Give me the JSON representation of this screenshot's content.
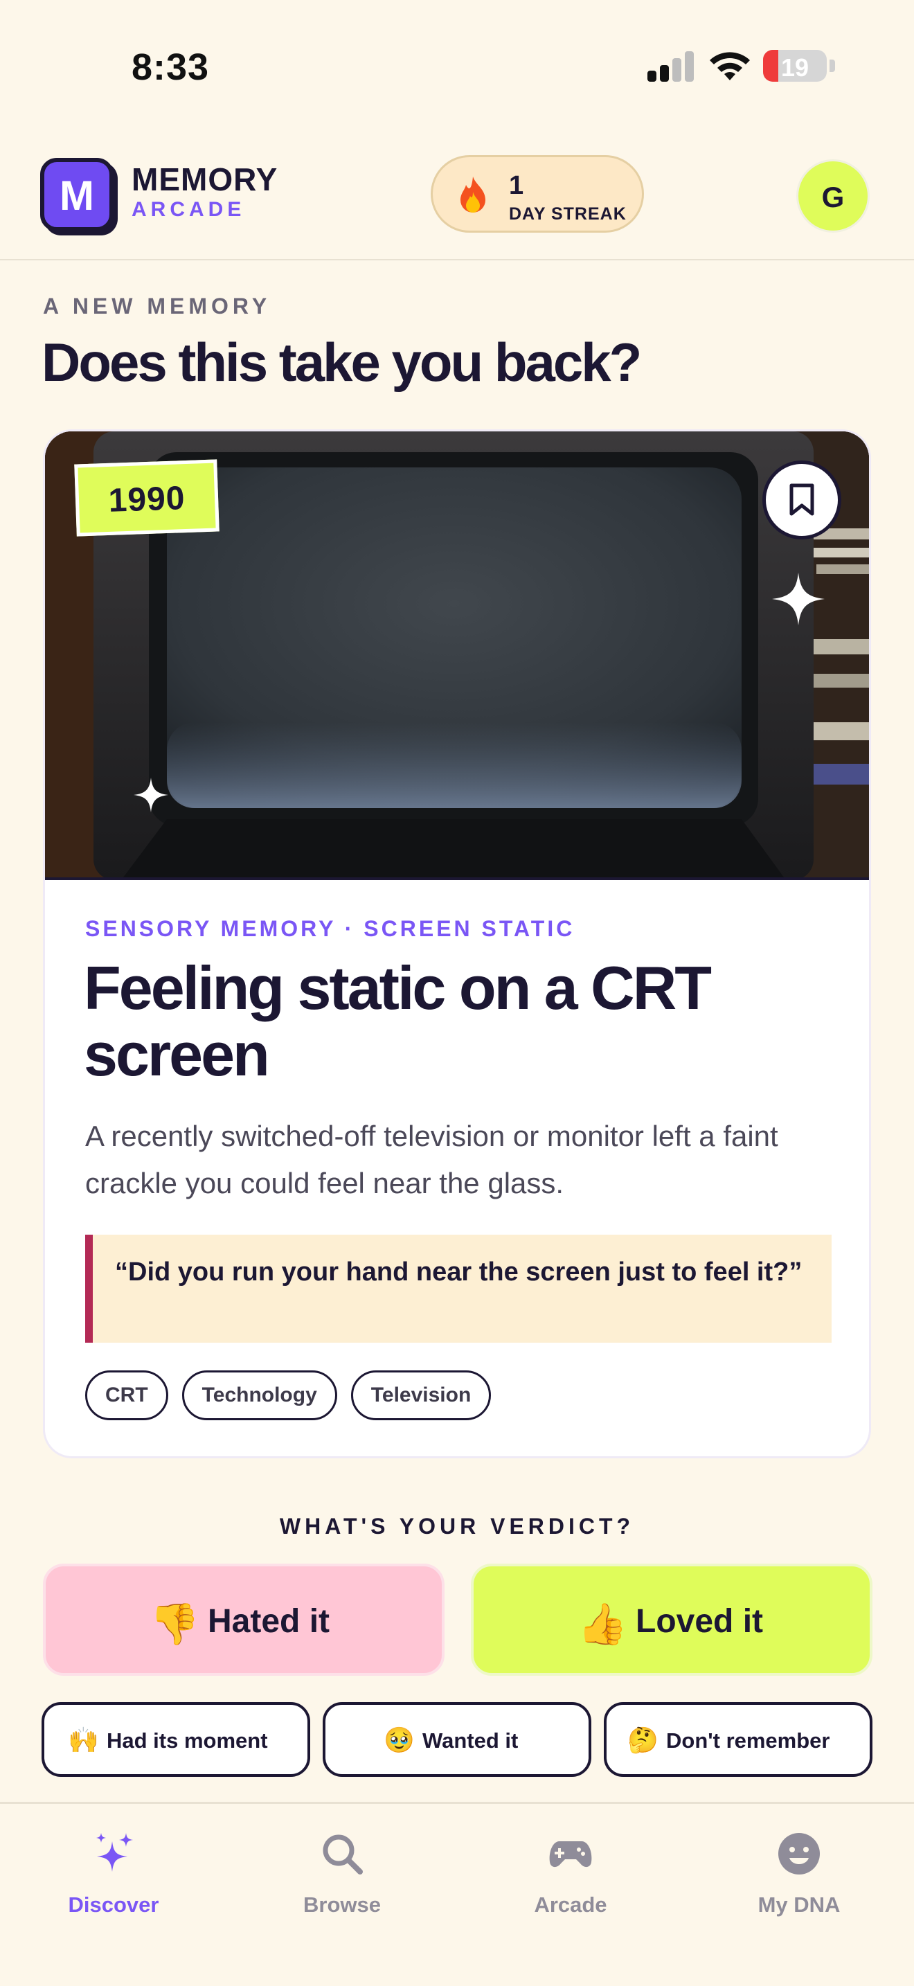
{
  "status_bar": {
    "time": "8:33",
    "battery": "19"
  },
  "header": {
    "brand_top": "MEMORY",
    "brand_bottom": "ARCADE",
    "logo_letter": "M",
    "streak_count": "1",
    "streak_label": "DAY STREAK",
    "avatar_initial": "G"
  },
  "section": {
    "eyebrow": "A NEW MEMORY",
    "headline": "Does this take you back?"
  },
  "memory_card": {
    "year": "1990",
    "category": "SENSORY MEMORY · SCREEN STATIC",
    "title": "Feeling static on a CRT screen",
    "description": "A recently switched-off television or monitor left a faint crackle you could feel near the glass.",
    "quote": "“Did you run your hand near the screen just to feel it?”",
    "tags": [
      "CRT",
      "Technology",
      "Television"
    ]
  },
  "verdict": {
    "label": "WHAT'S YOUR VERDICT?",
    "hated": {
      "emoji": "👎",
      "label": "Hated it"
    },
    "loved": {
      "emoji": "👍",
      "label": "Loved it"
    },
    "options": [
      {
        "emoji": "🙌",
        "label": "Had its moment"
      },
      {
        "emoji": "🥹",
        "label": "Wanted it"
      },
      {
        "emoji": "🤔",
        "label": "Don't remember"
      }
    ]
  },
  "tabbar": {
    "items": [
      {
        "label": "Discover",
        "icon": "sparkles-icon",
        "active": true
      },
      {
        "label": "Browse",
        "icon": "search-icon",
        "active": false
      },
      {
        "label": "Arcade",
        "icon": "gamepad-icon",
        "active": false
      },
      {
        "label": "My DNA",
        "icon": "smiley-icon",
        "active": false
      }
    ]
  },
  "colors": {
    "background": "#fdf7ea",
    "ink": "#1c1733",
    "accent_purple": "#7a56f5",
    "accent_lime": "#dffc5a",
    "hate_pink": "#ffc6d5",
    "quote_bar": "#b32a55"
  }
}
